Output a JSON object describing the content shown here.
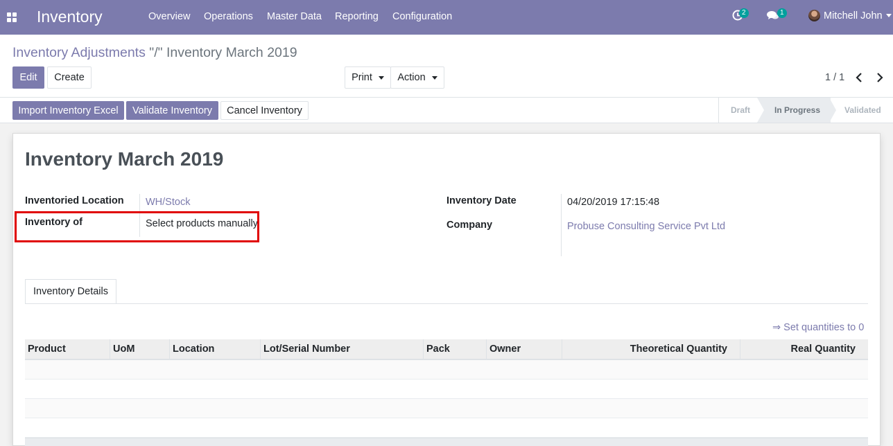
{
  "navbar": {
    "app_title": "Inventory",
    "menu": [
      "Overview",
      "Operations",
      "Master Data",
      "Reporting",
      "Configuration"
    ],
    "activity_badge": "2",
    "messages_badge": "1",
    "user_name": "Mitchell John",
    "color": "#7c7bad"
  },
  "breadcrumb": {
    "parent": "Inventory Adjustments",
    "separator": "\"/\"",
    "current": "Inventory March 2019"
  },
  "buttons": {
    "edit": "Edit",
    "create": "Create",
    "print": "Print",
    "action": "Action",
    "import_excel": "Import Inventory Excel",
    "validate": "Validate Inventory",
    "cancel": "Cancel Inventory"
  },
  "pager": {
    "value": "1 / 1"
  },
  "statusbar": {
    "stages": [
      "Draft",
      "In Progress",
      "Validated"
    ],
    "current": "In Progress"
  },
  "form": {
    "title": "Inventory March 2019",
    "fields": {
      "location_label": "Inventoried Location",
      "location_value": "WH/Stock",
      "inventory_of_label": "Inventory of",
      "inventory_of_value": "Select products manually",
      "date_label": "Inventory Date",
      "date_value": "04/20/2019 17:15:48",
      "company_label": "Company",
      "company_value": "Probuse Consulting Service Pvt Ltd"
    },
    "tab": "Inventory Details",
    "set_quantities": "⇒ Set quantities to 0",
    "table": {
      "columns": [
        "Product",
        "UoM",
        "Location",
        "Lot/Serial Number",
        "Pack",
        "Owner",
        "Theoretical Quantity",
        "Real Quantity"
      ],
      "rows": []
    }
  },
  "highlight_color": "#e00000"
}
